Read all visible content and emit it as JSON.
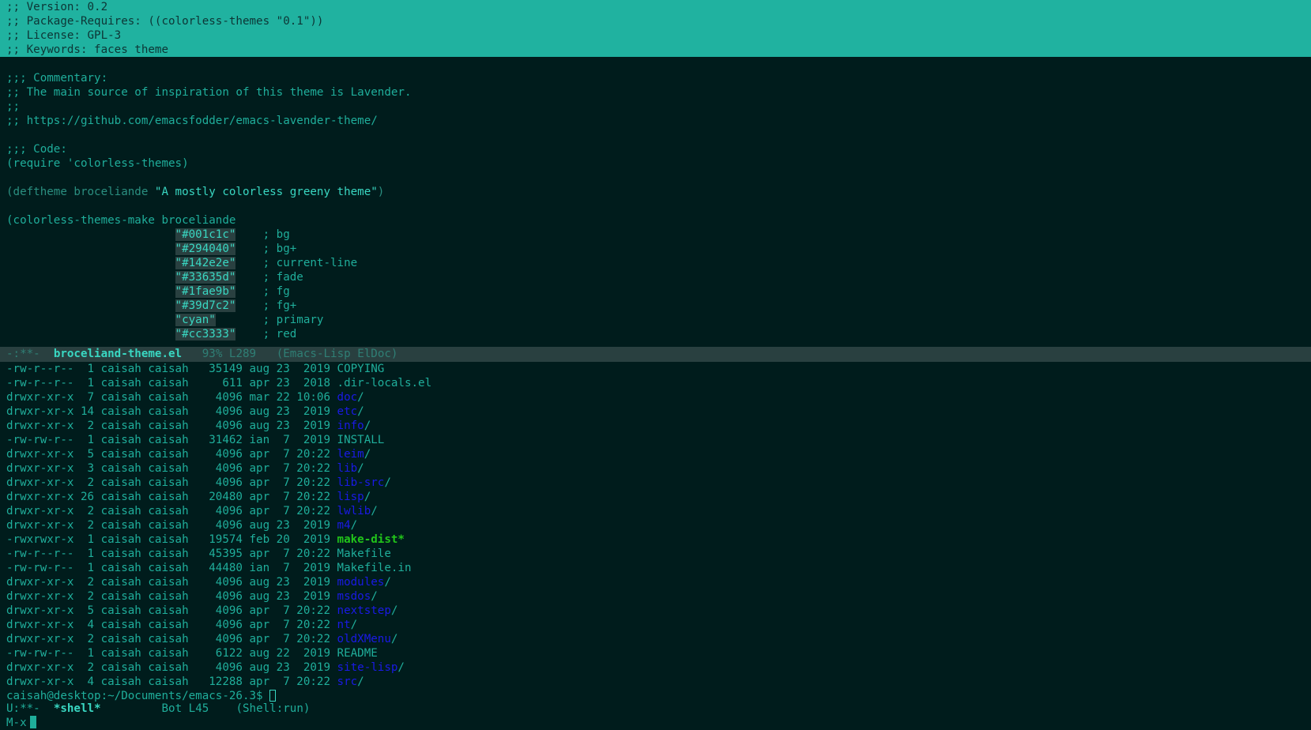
{
  "editor": {
    "header_lines": [
      ";; Version: 0.2",
      ";; Package-Requires: ((colorless-themes \"0.1\"))",
      ";; License: GPL-3",
      ";; Keywords: faces theme"
    ],
    "commentary_heading": ";;; Commentary:",
    "commentary_lines": [
      ";; The main source of inspiration of this theme is Lavender.",
      ";;",
      ";; https://github.com/emacsfodder/emacs-lavender-theme/"
    ],
    "code_heading": ";;; Code:",
    "require_line": "(require 'colorless-themes)",
    "deftheme_prefix": "(deftheme broceliande ",
    "deftheme_string": "\"A mostly colorless greeny theme\"",
    "deftheme_suffix": ")",
    "make_line": "(colorless-themes-make broceliande",
    "colors": [
      {
        "value": "\"#001c1c\"",
        "comment": "; bg"
      },
      {
        "value": "\"#294040\"",
        "comment": "; bg+"
      },
      {
        "value": "\"#142e2e\"",
        "comment": "; current-line"
      },
      {
        "value": "\"#33635d\"",
        "comment": "; fade"
      },
      {
        "value": "\"#1fae9b\"",
        "comment": "; fg"
      },
      {
        "value": "\"#39d7c2\"",
        "comment": "; fg+"
      },
      {
        "value": "\"cyan\"",
        "comment": "; primary"
      },
      {
        "value": "\"#cc3333\"",
        "comment": "; red"
      }
    ]
  },
  "modeline_top": {
    "status": "-:**-",
    "buffer": "broceliand-theme.el",
    "position": "93% L289",
    "modes": "(Emacs-Lisp ElDoc)"
  },
  "shell": {
    "listing": [
      {
        "perms": "-rw-r--r--",
        "links": " 1",
        "owner": "caisah",
        "group": "caisah",
        "size": "35149",
        "date": "aug 23  2019",
        "name": "COPYING",
        "kind": "file"
      },
      {
        "perms": "-rw-r--r--",
        "links": " 1",
        "owner": "caisah",
        "group": "caisah",
        "size": "  611",
        "date": "apr 23  2018",
        "name": ".dir-locals.el",
        "kind": "file"
      },
      {
        "perms": "drwxr-xr-x",
        "links": " 7",
        "owner": "caisah",
        "group": "caisah",
        "size": " 4096",
        "date": "mar 22 10:06",
        "name": "doc",
        "kind": "dir"
      },
      {
        "perms": "drwxr-xr-x",
        "links": "14",
        "owner": "caisah",
        "group": "caisah",
        "size": " 4096",
        "date": "aug 23  2019",
        "name": "etc",
        "kind": "dir"
      },
      {
        "perms": "drwxr-xr-x",
        "links": " 2",
        "owner": "caisah",
        "group": "caisah",
        "size": " 4096",
        "date": "aug 23  2019",
        "name": "info",
        "kind": "dir"
      },
      {
        "perms": "-rw-rw-r--",
        "links": " 1",
        "owner": "caisah",
        "group": "caisah",
        "size": "31462",
        "date": "ian  7  2019",
        "name": "INSTALL",
        "kind": "file"
      },
      {
        "perms": "drwxr-xr-x",
        "links": " 5",
        "owner": "caisah",
        "group": "caisah",
        "size": " 4096",
        "date": "apr  7 20:22",
        "name": "leim",
        "kind": "dir"
      },
      {
        "perms": "drwxr-xr-x",
        "links": " 3",
        "owner": "caisah",
        "group": "caisah",
        "size": " 4096",
        "date": "apr  7 20:22",
        "name": "lib",
        "kind": "dir"
      },
      {
        "perms": "drwxr-xr-x",
        "links": " 2",
        "owner": "caisah",
        "group": "caisah",
        "size": " 4096",
        "date": "apr  7 20:22",
        "name": "lib-src",
        "kind": "dir"
      },
      {
        "perms": "drwxr-xr-x",
        "links": "26",
        "owner": "caisah",
        "group": "caisah",
        "size": "20480",
        "date": "apr  7 20:22",
        "name": "lisp",
        "kind": "dir"
      },
      {
        "perms": "drwxr-xr-x",
        "links": " 2",
        "owner": "caisah",
        "group": "caisah",
        "size": " 4096",
        "date": "apr  7 20:22",
        "name": "lwlib",
        "kind": "dir"
      },
      {
        "perms": "drwxr-xr-x",
        "links": " 2",
        "owner": "caisah",
        "group": "caisah",
        "size": " 4096",
        "date": "aug 23  2019",
        "name": "m4",
        "kind": "dir"
      },
      {
        "perms": "-rwxrwxr-x",
        "links": " 1",
        "owner": "caisah",
        "group": "caisah",
        "size": "19574",
        "date": "feb 20  2019",
        "name": "make-dist",
        "kind": "exe"
      },
      {
        "perms": "-rw-r--r--",
        "links": " 1",
        "owner": "caisah",
        "group": "caisah",
        "size": "45395",
        "date": "apr  7 20:22",
        "name": "Makefile",
        "kind": "file"
      },
      {
        "perms": "-rw-rw-r--",
        "links": " 1",
        "owner": "caisah",
        "group": "caisah",
        "size": "44480",
        "date": "ian  7  2019",
        "name": "Makefile.in",
        "kind": "file"
      },
      {
        "perms": "drwxr-xr-x",
        "links": " 2",
        "owner": "caisah",
        "group": "caisah",
        "size": " 4096",
        "date": "aug 23  2019",
        "name": "modules",
        "kind": "dir"
      },
      {
        "perms": "drwxr-xr-x",
        "links": " 2",
        "owner": "caisah",
        "group": "caisah",
        "size": " 4096",
        "date": "aug 23  2019",
        "name": "msdos",
        "kind": "dir"
      },
      {
        "perms": "drwxr-xr-x",
        "links": " 5",
        "owner": "caisah",
        "group": "caisah",
        "size": " 4096",
        "date": "apr  7 20:22",
        "name": "nextstep",
        "kind": "dir"
      },
      {
        "perms": "drwxr-xr-x",
        "links": " 4",
        "owner": "caisah",
        "group": "caisah",
        "size": " 4096",
        "date": "apr  7 20:22",
        "name": "nt",
        "kind": "dir"
      },
      {
        "perms": "drwxr-xr-x",
        "links": " 2",
        "owner": "caisah",
        "group": "caisah",
        "size": " 4096",
        "date": "apr  7 20:22",
        "name": "oldXMenu",
        "kind": "dir"
      },
      {
        "perms": "-rw-rw-r--",
        "links": " 1",
        "owner": "caisah",
        "group": "caisah",
        "size": " 6122",
        "date": "aug 22  2019",
        "name": "README",
        "kind": "file"
      },
      {
        "perms": "drwxr-xr-x",
        "links": " 2",
        "owner": "caisah",
        "group": "caisah",
        "size": " 4096",
        "date": "aug 23  2019",
        "name": "site-lisp",
        "kind": "dir"
      },
      {
        "perms": "drwxr-xr-x",
        "links": " 4",
        "owner": "caisah",
        "group": "caisah",
        "size": "12288",
        "date": "apr  7 20:22",
        "name": "src",
        "kind": "dir"
      }
    ],
    "prompt": "caisah@desktop:~/Documents/emacs-26.3$ "
  },
  "modeline_bottom": {
    "status": "U:**-",
    "buffer": "*shell*",
    "position": "Bot L45",
    "modes": "(Shell:run)"
  },
  "minibuffer": {
    "text": "M-x"
  },
  "colors": {
    "bg": "#001c1c",
    "bg_plus": "#294040",
    "fg": "#1fae9b",
    "fg_plus": "#39d7c2",
    "header_highlight": "#20b2a0",
    "dir": "#1a1ae6",
    "exe": "#21c41a"
  }
}
